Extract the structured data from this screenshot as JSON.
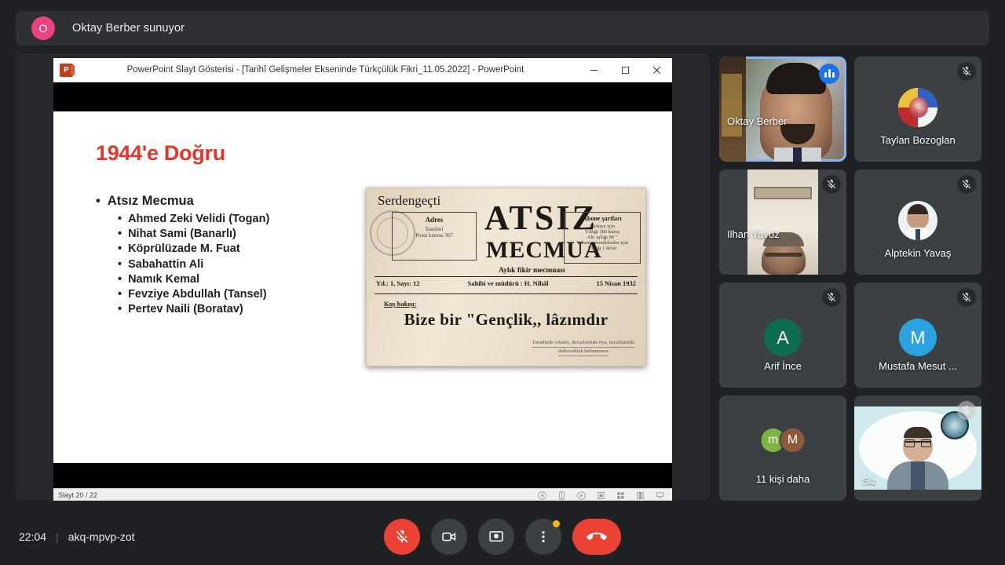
{
  "banner": {
    "avatar_letter": "O",
    "avatar_color": "#e8447f",
    "text": "Oktay Berber sunuyor"
  },
  "shared_window": {
    "app_logo_letter": "P",
    "title": "PowerPoint Slayt Gösterisi - [Tarihî Gelişmeler Ekseninde Türkçülük Fikri_11.05.2022] - PowerPoint",
    "window_buttons": [
      "minimize-button",
      "maximize-button",
      "close-button"
    ],
    "slide": {
      "title": "1944'e Doğru",
      "title_color": "#e8342a",
      "bullet_level1": "Atsız Mecmua",
      "bullet_level2": [
        "Ahmed Zeki Velidi (Togan)",
        "Nihat Sami (Banarlı)",
        "Köprülüzade M. Fuat",
        "Sabahattin Ali",
        "Namık Kemal",
        "Fevziye Abdullah (Tansel)",
        "Pertev Naili (Boratav)"
      ],
      "magazine": {
        "masthead_left": "Serdengeçti",
        "address_title": "Adres",
        "address_lines": "İstanbul\nPosta kutusu 367",
        "title_main": "ATSIZ",
        "title_sub": "MECMUA",
        "tagline": "Aylık fikir mecmuası",
        "subscription_title": "Abone şartları",
        "subscription_lines": "Türkiye için\nYıllığı 180 kuruş\nAltı aylığı 90 \"\nYabancı memleketler için\nYıllığı 1 dolar",
        "issue": "Yıl.: 1, Sayı: 12",
        "owner": "Sahibi ve müdürü : H. Nihâl",
        "date": "15 Nisan 1932",
        "section_label": "Kuş bakışı:",
        "headline": "Bize bir \"Gençlik,, lâzımdır",
        "footnote_line1": "Temelinde cehalet, duvarlarında riya, tavanlarında",
        "footnote_line2": "dalkavukluk bulunmasın"
      }
    },
    "status_bar": {
      "slide_counter": "Slayt 20 / 22",
      "nav_icons": [
        "previous-slide-icon",
        "pen-tool-icon",
        "next-slide-icon",
        "all-slides-icon",
        "grid-view-icon",
        "zoom-icon",
        "presenter-view-icon"
      ]
    }
  },
  "participants": [
    {
      "name": "Oktay Berber",
      "tile_type": "video",
      "is_active_speaker": true,
      "muted": false,
      "name_position": "left"
    },
    {
      "name": "Taylan Bozoglan",
      "tile_type": "avatar-photo",
      "is_active_speaker": false,
      "muted": true,
      "name_position": "center"
    },
    {
      "name": "Ilhan Yavuz",
      "tile_type": "video",
      "is_active_speaker": false,
      "muted": true,
      "name_position": "left"
    },
    {
      "name": "Alptekin Yavaş",
      "tile_type": "avatar-photo",
      "is_active_speaker": false,
      "muted": true,
      "name_position": "center"
    },
    {
      "name": "Arif İnce",
      "tile_type": "avatar-initial",
      "initial": "A",
      "avatar_color": "#0d6b4f",
      "is_active_speaker": false,
      "muted": true,
      "name_position": "center"
    },
    {
      "name": "Mustafa Mesut ...",
      "tile_type": "avatar-initial",
      "initial": "M",
      "avatar_color": "#2aa3e0",
      "is_active_speaker": false,
      "muted": true,
      "name_position": "center"
    },
    {
      "name": "11 kişi daha",
      "tile_type": "overflow",
      "overflow_initials": [
        "m",
        "M"
      ],
      "overflow_colors": [
        "#7cb342",
        "#8d5a3b"
      ],
      "is_active_speaker": false,
      "muted": false,
      "name_position": "center"
    },
    {
      "name": "Siz",
      "tile_type": "self-video",
      "is_active_speaker": false,
      "muted": true,
      "name_position": "left"
    }
  ],
  "bottom_bar": {
    "time": "22:04",
    "separator": "|",
    "meeting_code": "akq-mpvp-zot",
    "controls": [
      {
        "name": "microphone-off-button",
        "icon": "mic-off-icon",
        "style": "danger"
      },
      {
        "name": "camera-button",
        "icon": "camera-icon",
        "style": "neutral"
      },
      {
        "name": "present-screen-button",
        "icon": "present-icon",
        "style": "neutral"
      },
      {
        "name": "more-options-button",
        "icon": "more-vertical-icon",
        "style": "neutral",
        "badge": true
      },
      {
        "name": "end-call-button",
        "icon": "hangup-icon",
        "style": "hangup"
      }
    ]
  },
  "colors": {
    "background": "#202124",
    "banner": "#2f3033",
    "tile": "#3c4043",
    "accent_blue": "#8ab4f8",
    "danger_red": "#ea4335",
    "badge_orange": "#fbbc04"
  }
}
